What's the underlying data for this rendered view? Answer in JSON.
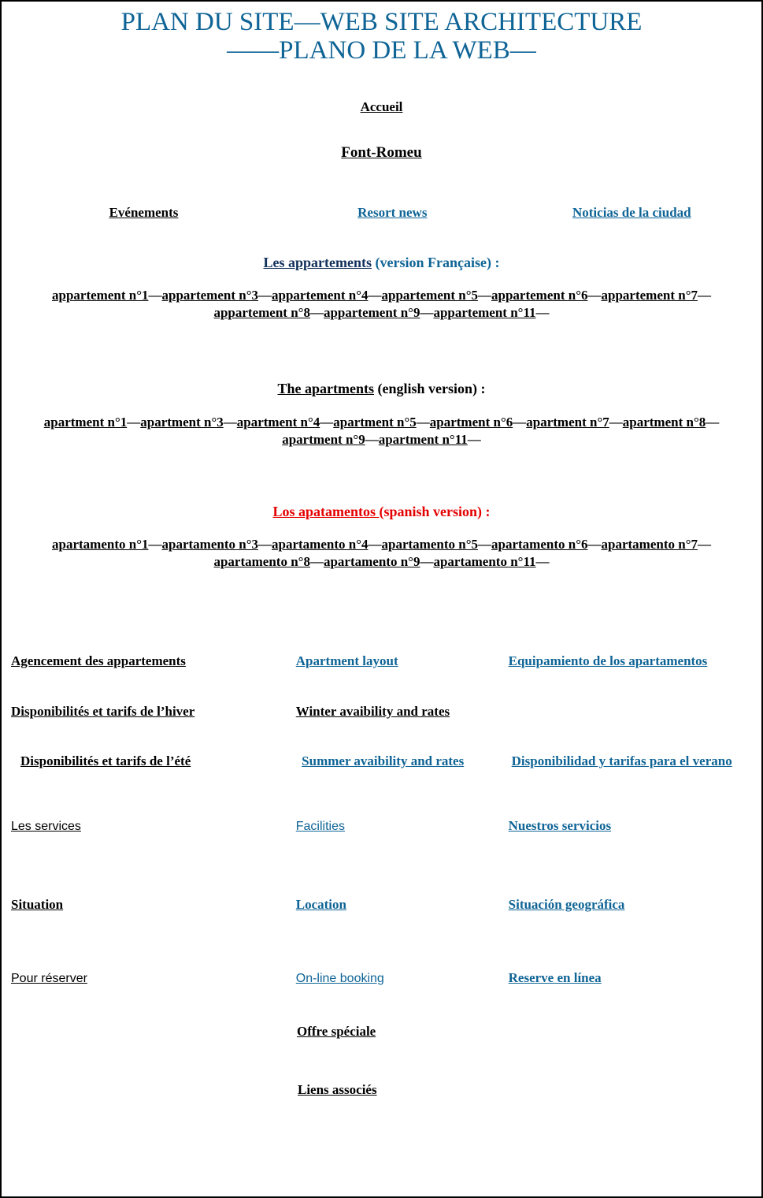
{
  "colors": {
    "title": "#0f6496",
    "link_teal": "#0f6496",
    "link_navy": "#12305c",
    "link_black": "#000000",
    "link_red": "#e40000",
    "page_border": "#000000",
    "background": "#ffffff"
  },
  "title": {
    "line1": "PLAN DU SITE—WEB SITE ARCHITECTURE",
    "line2": "——PLANO DE LA WEB—"
  },
  "home": {
    "accueil": "Accueil",
    "font_romeu": "Font-Romeu"
  },
  "news_row": {
    "fr": "Evénements",
    "en": "Resort news",
    "es": "Noticias de la ciudad"
  },
  "apartments_fr": {
    "heading_link": "Les appartements",
    "heading_suffix": " (version Française) :",
    "items": [
      "appartement n°1",
      "appartement n°3",
      "appartement n°4",
      "appartement n°5",
      "appartement n°6",
      "appartement n°7",
      "appartement n°8",
      "appartement n°9",
      "appartement n°11"
    ],
    "separator": "—"
  },
  "apartments_en": {
    "heading_link": "The apartments",
    "heading_suffix": " (english version) :",
    "items": [
      "apartment n°1",
      "apartment n°3",
      "apartment n°4",
      "apartment n°5",
      "apartment n°6",
      "apartment n°7",
      "apartment n°8",
      "apartment n°9",
      "apartment n°11"
    ],
    "separator": "—"
  },
  "apartments_es": {
    "heading_link": "Los apatamentos ",
    "heading_suffix": "(spanish version) :",
    "items": [
      "apartamento n°1",
      "apartamento n°3",
      "apartamento n°4",
      "apartamento n°5",
      "apartamento n°6",
      "apartamento n°7",
      "apartamento n°8",
      "apartamento n°9",
      "apartamento n°11"
    ],
    "separator": "—"
  },
  "layout_row": {
    "fr": "Agencement des appartements",
    "en": "Apartment layout",
    "es": "Equipamiento de los apartamentos"
  },
  "winter_row": {
    "fr": "Disponibilités et tarifs de l’hiver",
    "en": "Winter avaibility and rates",
    "es": ""
  },
  "summer_row": {
    "fr": "Disponibilités et tarifs de l’été",
    "en": "Summer avaibility and rates",
    "es": "Disponibilidad y tarifas para el verano"
  },
  "services_row": {
    "fr": "Les services",
    "en": "Facilities",
    "es": "Nuestros servicios"
  },
  "situation_row": {
    "fr": "Situation",
    "en": "Location",
    "es": "Situación geográfica"
  },
  "booking_row": {
    "fr": "Pour réserver",
    "en": "On-line booking",
    "es": "Reserve en línea"
  },
  "special_offer": "Offre spéciale",
  "related_links": "Liens associés"
}
